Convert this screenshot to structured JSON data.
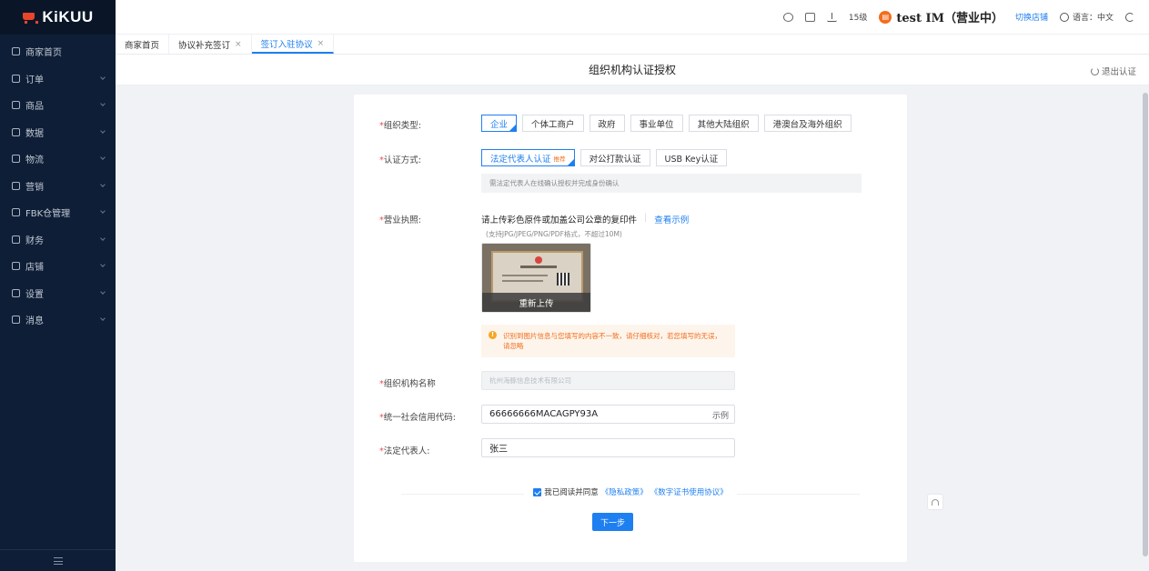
{
  "brand": {
    "logo_text": "KiKUU"
  },
  "sidebar": {
    "items": [
      {
        "label": "商家首页",
        "icon": "monitor-icon"
      },
      {
        "label": "订单",
        "icon": "order-icon"
      },
      {
        "label": "商品",
        "icon": "product-icon"
      },
      {
        "label": "数据",
        "icon": "chart-icon"
      },
      {
        "label": "物流",
        "icon": "location-icon"
      },
      {
        "label": "营销",
        "icon": "marketing-icon"
      },
      {
        "label": "FBK仓管理",
        "icon": "warehouse-icon"
      },
      {
        "label": "财务",
        "icon": "shield-icon"
      },
      {
        "label": "店铺",
        "icon": "store-icon"
      },
      {
        "label": "设置",
        "icon": "gear-icon"
      },
      {
        "label": "消息",
        "icon": "message-icon"
      }
    ]
  },
  "header": {
    "level": "15级",
    "store_name": "test IM（营业中）",
    "switch_store": "切换店铺",
    "language": "语言：中文"
  },
  "tabs": [
    {
      "label": "商家首页",
      "closable": false,
      "active": false
    },
    {
      "label": "协议补充签订",
      "closable": true,
      "active": false
    },
    {
      "label": "签订入驻协议",
      "closable": true,
      "active": true
    }
  ],
  "page": {
    "title": "组织机构认证授权",
    "exit_label": "退出认证"
  },
  "form": {
    "org_type": {
      "label": "组织类型:",
      "options": [
        "企业",
        "个体工商户",
        "政府",
        "事业单位",
        "其他大陆组织",
        "港澳台及海外组织"
      ],
      "selected": "企业"
    },
    "auth_method": {
      "label": "认证方式:",
      "options": [
        "法定代表人认证",
        "对公打款认证",
        "USB Key认证"
      ],
      "selected": "法定代表人认证",
      "recommend_badge": "推荐",
      "hint": "需法定代表人在线确认授权并完成身份确认"
    },
    "license": {
      "label": "营业执照:",
      "title": "请上传彩色原件或加盖公司公章的复印件",
      "example_link": "查看示例",
      "sub": "(支持JPG/JPEG/PNG/PDF格式，不超过10M)",
      "reupload": "重新上传",
      "warning": "识别到图片信息与您填写的内容不一致，请仔细核对，若您填写的无误，请忽略"
    },
    "org_name": {
      "label": "组织机构名称",
      "value": "杭州海豚信息技术有限公司"
    },
    "credit_code": {
      "label": "统一社会信用代码:",
      "value": "66666666MACAGPY93A",
      "suffix": "示例"
    },
    "legal_rep": {
      "label": "法定代表人:",
      "value": "张三"
    },
    "agree": {
      "text": "我已阅读并同意",
      "privacy": "《隐私政策》",
      "cert": "《数字证书使用协议》"
    },
    "next_button": "下一步"
  },
  "colors": {
    "primary": "#1e7ff0",
    "sidebar_bg": "#0e1e36",
    "warning": "#f36d1c",
    "required": "#f04b4b"
  }
}
